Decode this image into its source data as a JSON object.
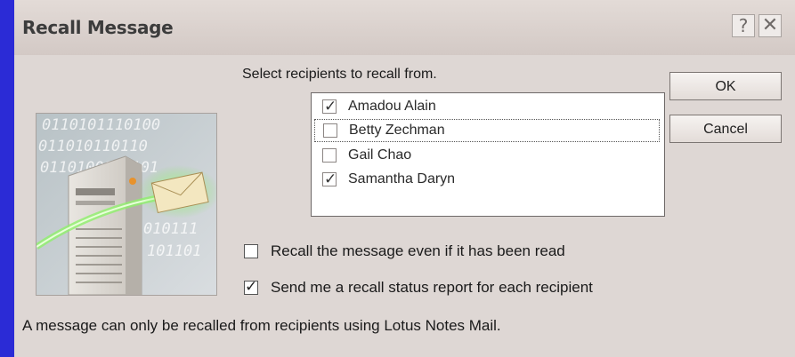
{
  "dialog": {
    "title": "Recall Message",
    "help_glyph": "?",
    "close_glyph": "✕"
  },
  "illustration": {
    "icon": "mail-server-illustration",
    "binary_lines": [
      "0110101110100",
      "011010110110",
      "0110100101101",
      "010111",
      "101101"
    ]
  },
  "prompt": "Select recipients to recall from.",
  "recipients": [
    {
      "name": "Amadou Alain",
      "checked": true,
      "focused": false
    },
    {
      "name": "Betty Zechman",
      "checked": false,
      "focused": true
    },
    {
      "name": "Gail Chao",
      "checked": false,
      "focused": false
    },
    {
      "name": "Samantha Daryn",
      "checked": true,
      "focused": false
    }
  ],
  "buttons": {
    "ok": "OK",
    "cancel": "Cancel"
  },
  "options": {
    "recall_even_if_read": {
      "label": "Recall the message even if it has been read",
      "checked": false
    },
    "status_report": {
      "label": "Send me a recall status report for each recipient",
      "checked": true
    }
  },
  "footer": "A message can only be recalled from recipients using Lotus Notes Mail.",
  "colors": {
    "desktop": "#2b2bd6",
    "dialog_bg": "#ded7d4",
    "envelope_glow": "#7ee65a"
  }
}
